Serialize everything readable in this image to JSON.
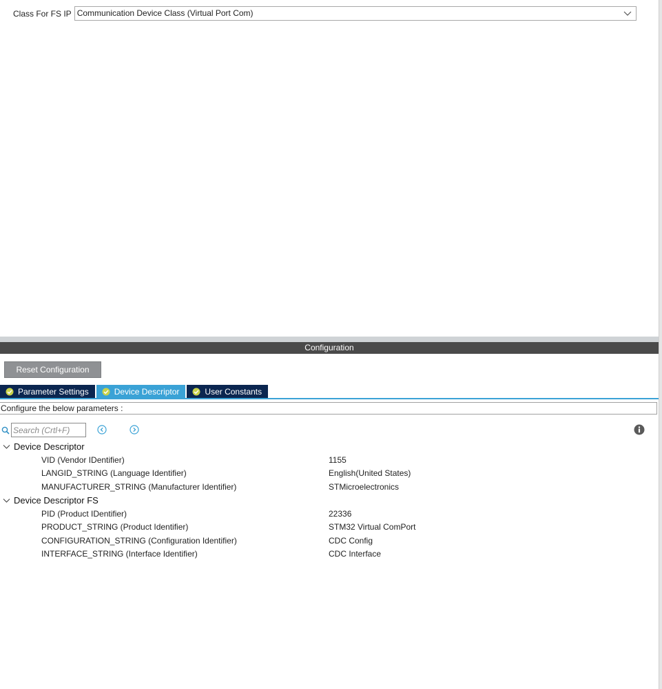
{
  "class_selector": {
    "label": "Class For FS IP",
    "value": "Communication Device Class (Virtual Port Com)"
  },
  "configuration": {
    "header": "Configuration",
    "reset_label": "Reset Configuration",
    "tabs": [
      {
        "label": "Parameter Settings",
        "active": false
      },
      {
        "label": "Device Descriptor",
        "active": true
      },
      {
        "label": "User Constants",
        "active": false
      }
    ],
    "instruction": "Configure the below parameters :",
    "search_placeholder": "Search (Crtl+F)"
  },
  "tree": {
    "groups": [
      {
        "label": "Device Descriptor",
        "params": [
          {
            "name": "VID (Vendor IDentifier)",
            "value": "1155"
          },
          {
            "name": "LANGID_STRING (Language Identifier)",
            "value": "English(United States)"
          },
          {
            "name": "MANUFACTURER_STRING (Manufacturer Identifier)",
            "value": "STMicroelectronics"
          }
        ]
      },
      {
        "label": "Device Descriptor FS",
        "params": [
          {
            "name": "PID (Product IDentifier)",
            "value": "22336"
          },
          {
            "name": "PRODUCT_STRING (Product Identifier)",
            "value": "STM32 Virtual ComPort"
          },
          {
            "name": "CONFIGURATION_STRING (Configuration Identifier)",
            "value": "CDC Config"
          },
          {
            "name": "INTERFACE_STRING (Interface Identifier)",
            "value": "CDC Interface"
          }
        ]
      }
    ]
  },
  "icons": {
    "dropdown": "chevron-down-icon",
    "tab_status": "check-circle-icon",
    "search": "search-icon",
    "prev": "chevron-left-circle-icon",
    "next": "chevron-right-circle-icon",
    "info": "info-icon",
    "expand": "chevron-down-icon"
  },
  "colors": {
    "tab_active": "#3aa2d6",
    "tab_inactive": "#0b2650",
    "check": "#c8d24a",
    "header_bar": "#4a4a4a",
    "reset_button": "#8f9194"
  }
}
